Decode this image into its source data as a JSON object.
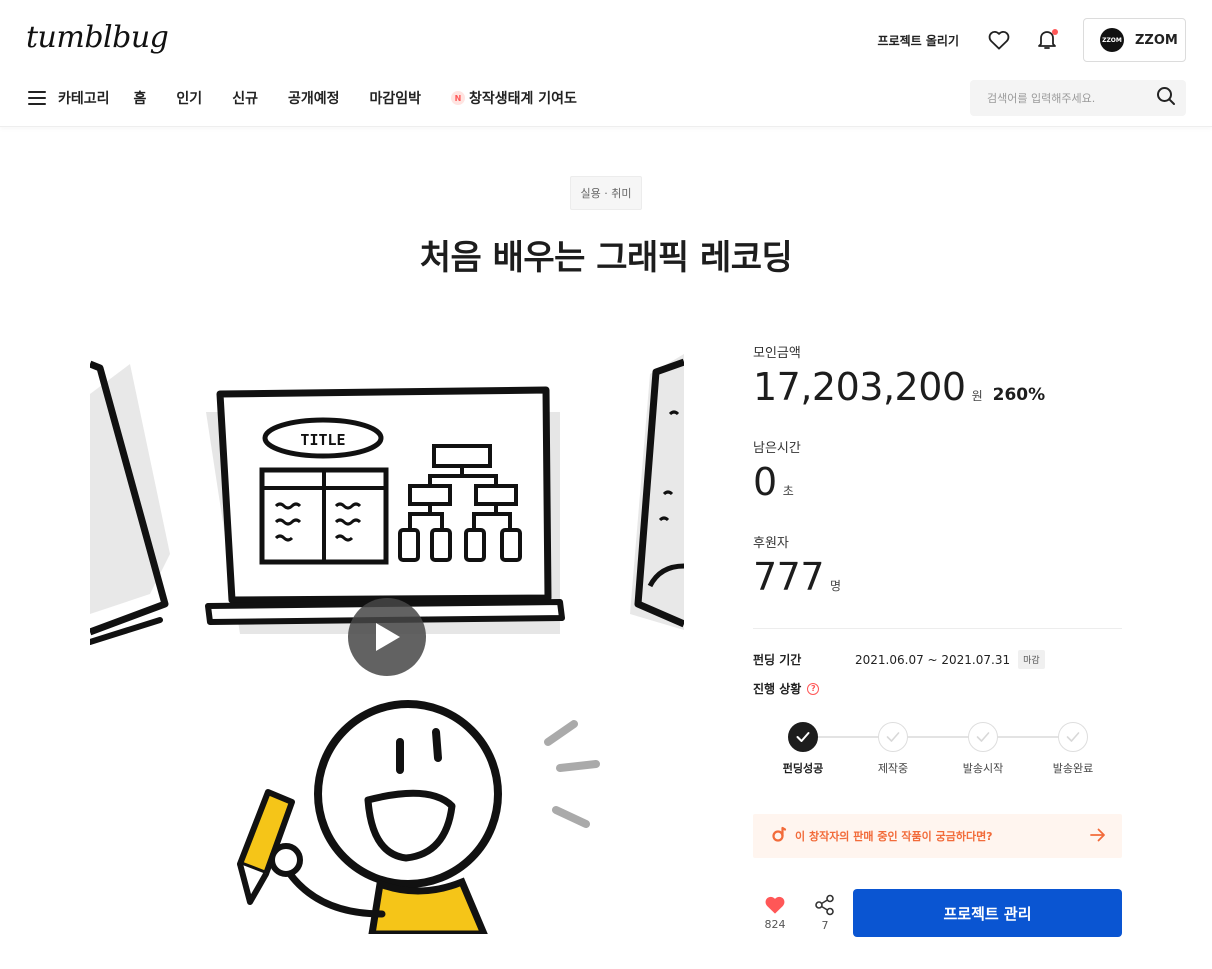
{
  "header": {
    "logo": "tumblbug",
    "upload_project": "프로젝트 올리기",
    "profile": {
      "avatar_text": "ZZOM",
      "name": "ZZOM"
    },
    "icons": {
      "like": "heart-icon",
      "notifications": "bell-icon",
      "menu": "hamburger-icon",
      "search": "search-icon"
    },
    "colors": {
      "notification_dot": "#ff5757"
    }
  },
  "nav": {
    "category": "카테고리",
    "items": [
      "홈",
      "인기",
      "신규",
      "공개예정",
      "마감임박"
    ],
    "special": {
      "badge": "N",
      "label": "창작생태계 기여도"
    }
  },
  "search": {
    "placeholder": "검색어를 입력해주세요."
  },
  "project": {
    "category": "실용 · 취미",
    "title": "처음 배우는 그래픽 레코딩",
    "media_text": "TITLE"
  },
  "stats": {
    "amount_label": "모인금액",
    "amount": "17,203,200",
    "amount_unit": "원",
    "percent": "260%",
    "time_label": "남은시간",
    "time": "0",
    "time_unit": "초",
    "backers_label": "후원자",
    "backers": "777",
    "backers_unit": "명"
  },
  "funding": {
    "period_label": "펀딩 기간",
    "period": "2021.06.07 ~ 2021.07.31",
    "closed_badge": "마감",
    "status_label": "진행 상황",
    "help_icon": "?",
    "steps": [
      {
        "label": "펀딩성공",
        "done": true
      },
      {
        "label": "제작중",
        "done": false
      },
      {
        "label": "발송시작",
        "done": false
      },
      {
        "label": "발송완료",
        "done": false
      }
    ]
  },
  "promo": {
    "text": "이 창작자의 판매 중인 작품이 궁금하다면?",
    "color": "#f26b3a"
  },
  "actions": {
    "like_count": "824",
    "share_count": "7",
    "manage_label": "프로젝트 관리",
    "manage_color": "#0a55d2"
  }
}
